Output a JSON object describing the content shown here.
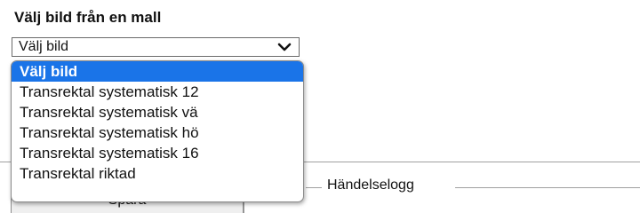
{
  "section": {
    "title": "Välj bild från en mall"
  },
  "select": {
    "value": "Välj bild",
    "icon": "chevron-down-icon",
    "options": [
      {
        "label": "Välj bild",
        "selected": true
      },
      {
        "label": "Transrektal systematisk 12",
        "selected": false
      },
      {
        "label": "Transrektal systematisk vä",
        "selected": false
      },
      {
        "label": "Transrektal systematisk hö",
        "selected": false
      },
      {
        "label": "Transrektal systematisk 16",
        "selected": false
      },
      {
        "label": "Transrektal riktad",
        "selected": false
      }
    ]
  },
  "save_button": {
    "label": "Spara"
  },
  "event_log": {
    "legend": "Händelselogg"
  },
  "colors": {
    "selected_option_bg": "#1a74e8",
    "border": "#8a8a8a"
  }
}
